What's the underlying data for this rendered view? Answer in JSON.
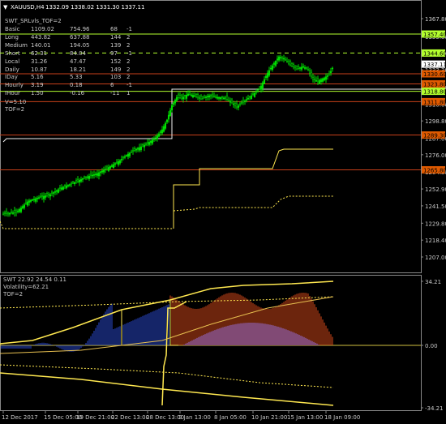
{
  "header": {
    "symbol": "XAUUSD,H4",
    "ohlc": "1332.09 1338.02 1331.30 1337.11"
  },
  "indicator_table": {
    "title": "SWT_SRLvls_TOF=2",
    "rows": [
      {
        "name": "Basic",
        "a": "1109.02",
        "b": "754.96",
        "c": "68",
        "d": "-1"
      },
      {
        "name": "Long",
        "a": "443.82",
        "b": "637.88",
        "c": "144",
        "d": "2"
      },
      {
        "name": "Medium",
        "a": "140.01",
        "b": "194.05",
        "c": "139",
        "d": "2"
      },
      {
        "name": "Short",
        "a": "62.31",
        "b": "84.04",
        "c": "97",
        "d": "-1"
      },
      {
        "name": "Local",
        "a": "31.26",
        "b": "47.47",
        "c": "152",
        "d": "2"
      },
      {
        "name": "Daily",
        "a": "10.87",
        "b": "18.21",
        "c": "149",
        "d": "2"
      },
      {
        "name": "IDay",
        "a": "5.16",
        "b": "5.33",
        "c": "103",
        "d": "2"
      },
      {
        "name": "Hourly",
        "a": "3.19",
        "b": "0.18",
        "c": "6",
        "d": "-1"
      },
      {
        "name": "IHour",
        "a": "1.50",
        "b": "-0.16",
        "c": "-11",
        "d": "1"
      }
    ],
    "v_line": "V=5.10",
    "tof_line": "TOF=2"
  },
  "price_axis": {
    "labels": [
      "1367.80",
      "1355.80",
      "1344.60",
      "1333.30",
      "1321.60",
      "1310.00",
      "1298.80",
      "1287.00",
      "1276.00",
      "1264.30",
      "1252.90",
      "1241.50",
      "1229.80",
      "1218.40",
      "1207.00"
    ],
    "tags": [
      {
        "text": "1357.40",
        "color": "#b3ff2e",
        "tcolor": "#000"
      },
      {
        "text": "1344.60",
        "color": "#b3ff2e",
        "tcolor": "#000"
      },
      {
        "text": "1337.11",
        "color": "#ffffff",
        "tcolor": "#000"
      },
      {
        "text": "1330.60",
        "color": "#e05a00",
        "tcolor": "#000"
      },
      {
        "text": "1323.80",
        "color": "#e05a00",
        "tcolor": "#000"
      },
      {
        "text": "1318.80",
        "color": "#b3ff2e",
        "tcolor": "#000"
      },
      {
        "text": "1311.80",
        "color": "#e05a00",
        "tcolor": "#000"
      },
      {
        "text": "1289.30",
        "color": "#e05a00",
        "tcolor": "#000"
      },
      {
        "text": "1265.80",
        "color": "#e05a00",
        "tcolor": "#000"
      }
    ]
  },
  "sub_window": {
    "title": "SWT 22.92 24.54 0.11",
    "volatility": "Volatility=62.21",
    "tof": "TOF=2",
    "axis_labels": [
      "34.21",
      "0.00",
      "-34.21"
    ]
  },
  "time_axis": {
    "labels": [
      "12 Dec 2017",
      "15 Dec 05:00",
      "19 Dec 21:00",
      "22 Dec 13:00",
      "28 Dec 13:00",
      "3 Jan 13:00",
      "8 Jan 05:00",
      "10 Jan 21:00",
      "15 Jan 13:00",
      "18 Jan 09:00"
    ]
  },
  "colors": {
    "bull": "#00e000",
    "level_green": "#b3ff2e",
    "level_red": "#c8401a",
    "band_yellow": "#ffe850",
    "hist_orange": "#d84a1a",
    "hist_blue": "#2a4ad0"
  }
}
